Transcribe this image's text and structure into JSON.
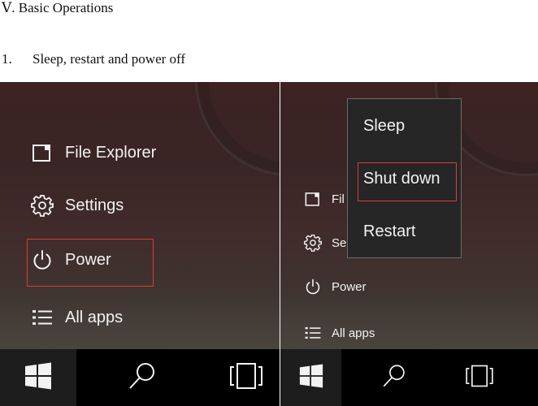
{
  "document": {
    "heading": "Ⅴ. Basic Operations",
    "step_number": "1.",
    "step_title": "Sleep, restart and power off"
  },
  "left_panel": {
    "menu_items": [
      {
        "label": "File Explorer",
        "icon": "file-explorer-icon"
      },
      {
        "label": "Settings",
        "icon": "gear-icon"
      },
      {
        "label": "Power",
        "icon": "power-icon",
        "highlighted": true
      },
      {
        "label": "All apps",
        "icon": "all-apps-icon"
      }
    ],
    "taskbar": [
      "windows-start-icon",
      "search-icon",
      "task-view-icon"
    ]
  },
  "right_panel": {
    "menu_items": [
      {
        "label": "Fil",
        "icon": "file-explorer-icon"
      },
      {
        "label": "Se",
        "icon": "gear-icon"
      },
      {
        "label": "Power",
        "icon": "power-icon"
      },
      {
        "label": "All apps",
        "icon": "all-apps-icon"
      }
    ],
    "power_menu": [
      {
        "label": "Sleep"
      },
      {
        "label": "Shut down",
        "highlighted": true
      },
      {
        "label": "Restart"
      }
    ],
    "taskbar": [
      "windows-start-icon",
      "search-icon",
      "task-view-icon"
    ]
  },
  "colors": {
    "highlight_border": "#e03a3a",
    "menu_text": "#f2f2f2",
    "taskbar": "#000000",
    "power_menu_bg": "#262626"
  }
}
